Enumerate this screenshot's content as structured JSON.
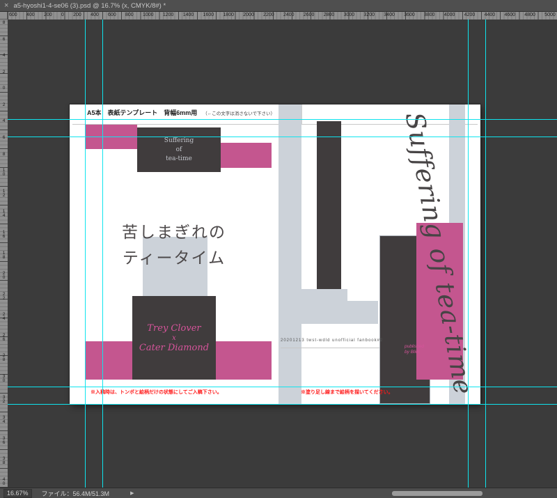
{
  "window": {
    "tab_close": "×",
    "tab_title": "a5-hyoshi1-4-se06 (3).psd @ 16.7% (x, CMYK/8#) *"
  },
  "rulers": {
    "horizontal_labels": [
      "600",
      "400",
      "200",
      "0",
      "200",
      "400",
      "600",
      "800",
      "1000",
      "1200",
      "1400",
      "1600",
      "1800",
      "2000",
      "2200",
      "2400",
      "2600",
      "2800",
      "3000",
      "3200",
      "3400",
      "3600",
      "3800",
      "4000",
      "4200",
      "4400",
      "4600",
      "4800",
      "5000"
    ],
    "vertical_labels": [
      "8",
      "6",
      "4",
      "2",
      "0",
      "2",
      "4",
      "6",
      "8",
      "10",
      "12",
      "14",
      "16",
      "18",
      "20",
      "22",
      "24",
      "26",
      "28",
      "30",
      "32",
      "34",
      "36",
      "38",
      "40"
    ]
  },
  "document": {
    "header_title": "A5本　表紙テンプレート　背幅6mm用",
    "header_note": "（←この文字は消さないで下さい）",
    "back_cover": {
      "logo": [
        "Suffering",
        "of",
        "tea-time"
      ],
      "title_line1": "苦しまぎれの",
      "title_line2": "ティータイム",
      "credit_line1": "Trey Clover",
      "credit_line2": "x",
      "credit_line3": "Cater Diamond"
    },
    "spine_caption": "20201213  twst-wdld unofficial  fanbook#2",
    "front_cover": {
      "script_title": "Suffering of tea-time",
      "published_line1": "published",
      "published_line2": "by Blim"
    },
    "notes": {
      "left": "※入稿時は、トンボと絵柄だけの状態にしてご入稿下さい。",
      "right": "※塗り足し線まで絵柄を描いてください。"
    }
  },
  "statusbar": {
    "zoom": "16.67%",
    "file_label": "ファイル：56.4M/51.3M",
    "expander": "▶"
  },
  "colors": {
    "accent_pink": "#c4568f",
    "panel_dark": "#403c3d",
    "light_gray_block": "#ccd2d9",
    "script_pink": "#d6549b",
    "guide_cyan": "#0ee4ee",
    "note_red": "#ff1a1a"
  }
}
